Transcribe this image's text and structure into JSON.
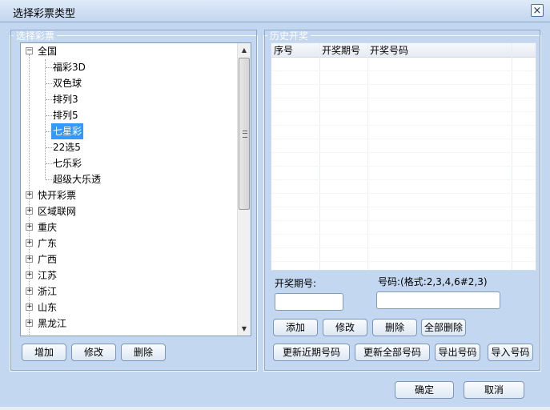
{
  "window": {
    "title": "选择彩票类型",
    "close_glyph": "×"
  },
  "left_panel": {
    "legend": "选择彩票",
    "tree": [
      {
        "label": "全国",
        "expander": "−"
      },
      {
        "label": "福彩3D"
      },
      {
        "label": "双色球"
      },
      {
        "label": "排列3"
      },
      {
        "label": "排列5"
      },
      {
        "label": "七星彩"
      },
      {
        "label": "22选5"
      },
      {
        "label": "七乐彩"
      },
      {
        "label": "超级大乐透"
      },
      {
        "label": "快开彩票",
        "expander": "+"
      },
      {
        "label": "区域联网",
        "expander": "+"
      },
      {
        "label": "重庆",
        "expander": "+"
      },
      {
        "label": "广东",
        "expander": "+"
      },
      {
        "label": "广西",
        "expander": "+"
      },
      {
        "label": "江苏",
        "expander": "+"
      },
      {
        "label": "浙江",
        "expander": "+"
      },
      {
        "label": "山东",
        "expander": "+"
      },
      {
        "label": "黑龙江",
        "expander": "+"
      }
    ],
    "buttons": {
      "add": "增加",
      "edit": "修改",
      "delete": "删除"
    }
  },
  "right_panel": {
    "legend": "历史开奖",
    "grid": {
      "columns": [
        "序号",
        "开奖期号",
        "开奖号码"
      ]
    },
    "period_label": "开奖期号:",
    "number_label": "号码:(格式:2,3,4,6#2,3)",
    "period_value": "",
    "number_value": "",
    "buttons": {
      "add": "添加",
      "edit": "修改",
      "delete": "删除",
      "delete_all": "全部删除",
      "update_recent": "更新近期号码",
      "update_all": "更新全部号码",
      "export": "导出号码",
      "import": "导入号码"
    }
  },
  "footer": {
    "ok": "确定",
    "cancel": "取消"
  },
  "icons": {
    "close": "close-icon",
    "expand": "plus-icon",
    "collapse": "minus-icon",
    "scroll_up": "arrow-up-icon",
    "scroll_down": "arrow-down-icon"
  }
}
